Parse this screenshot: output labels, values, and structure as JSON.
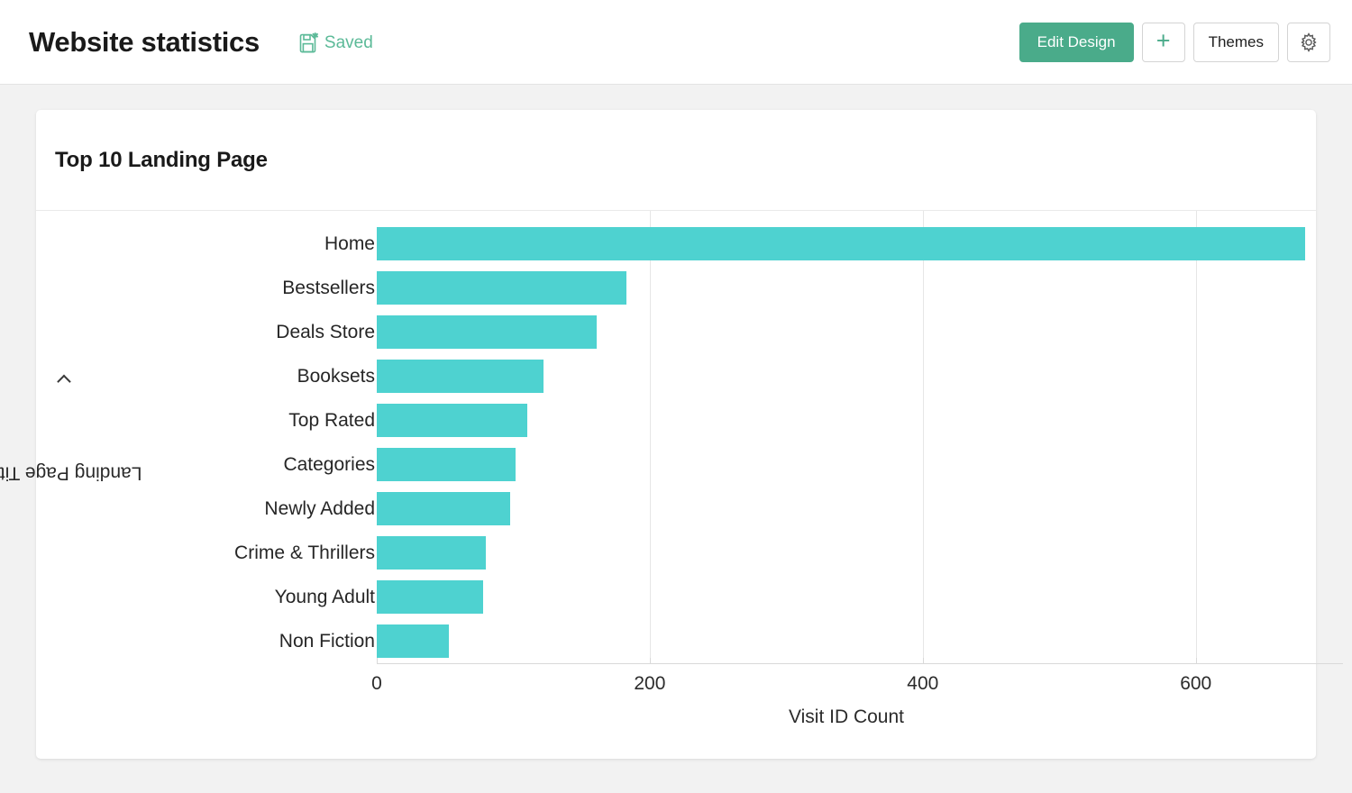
{
  "header": {
    "title": "Website statistics",
    "saved_label": "Saved",
    "saved_icon": "save-disk-asterisk-icon",
    "accent_green": "#4aab8a",
    "actions": {
      "edit_design_label": "Edit Design",
      "add_label": "+",
      "add_icon": "plus-icon",
      "themes_label": "Themes",
      "settings_icon": "gear-icon"
    }
  },
  "card": {
    "title": "Top 10 Landing Page"
  },
  "chart_data": {
    "type": "bar",
    "orientation": "horizontal",
    "title": "Top 10 Landing Page",
    "xlabel": "Visit ID Count",
    "ylabel": "Landing Page Title",
    "ylabel_chevron": "chevron-right-icon",
    "categories": [
      "Home",
      "Bestsellers",
      "Deals Store",
      "Booksets",
      "Top Rated",
      "Categories",
      "Newly Added",
      "Crime & Thrillers",
      "Young Adult",
      "Non Fiction"
    ],
    "values": [
      680,
      183,
      161,
      122,
      110,
      102,
      98,
      80,
      78,
      53
    ],
    "xticks": [
      0,
      200,
      400,
      600
    ],
    "xlim": [
      0,
      688
    ],
    "grid": "vertical",
    "legend": "none",
    "bar_color": "#4ed2d0"
  }
}
